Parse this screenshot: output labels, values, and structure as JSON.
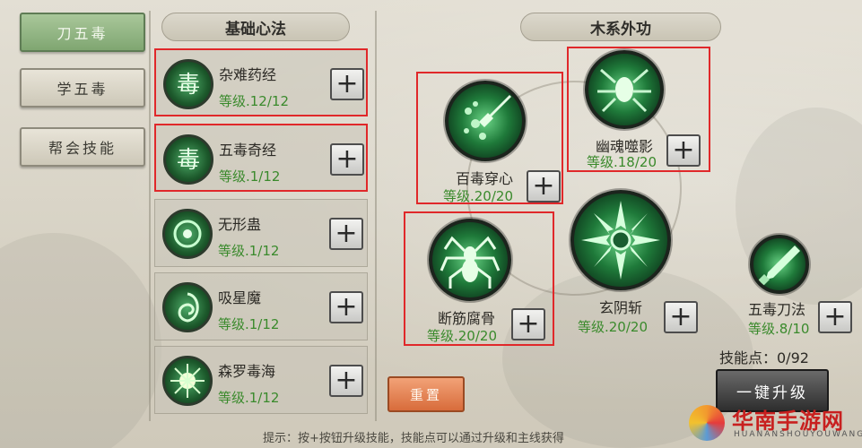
{
  "tabs": [
    {
      "label": "刀五毒",
      "active": true
    },
    {
      "label": "学五毒",
      "active": false
    },
    {
      "label": "帮会技能",
      "active": false
    }
  ],
  "sections": {
    "basic_title": "基础心法",
    "wood_title": "木系外功"
  },
  "basic_skills": [
    {
      "name": "杂难药经",
      "level": "等级.12/12",
      "icon": "poison-char-icon"
    },
    {
      "name": "五毒奇经",
      "level": "等级.1/12",
      "icon": "poison-char-icon"
    },
    {
      "name": "无形蛊",
      "level": "等级.1/12",
      "icon": "orb-icon"
    },
    {
      "name": "吸星魔",
      "level": "等级.1/12",
      "icon": "vortex-icon"
    },
    {
      "name": "森罗毒海",
      "level": "等级.1/12",
      "icon": "burst-icon"
    }
  ],
  "tree_skills": [
    {
      "name": "百毒穿心",
      "level": "等级.20/20"
    },
    {
      "name": "幽魂噬影",
      "level": "等级.18/20"
    },
    {
      "name": "断筋腐骨",
      "level": "等级.20/20"
    },
    {
      "name": "玄阴斩",
      "level": "等级.20/20"
    },
    {
      "name": "五毒刀法",
      "level": "等级.8/10"
    }
  ],
  "plus_label": "+",
  "points_label": "技能点：0/92",
  "reset_label": "重置",
  "upgrade_label": "一键升级",
  "hint": "提示：按+按钮升级技能，技能点可以通过升级和主线获得",
  "watermark": {
    "title": "华南手游网",
    "sub": "HUANANSHOUYOUWANG"
  },
  "colors": {
    "highlight": "#e0282a",
    "level_green": "#3a8a2c",
    "active_tab": "#8fb580",
    "reset": "#e07a45"
  }
}
